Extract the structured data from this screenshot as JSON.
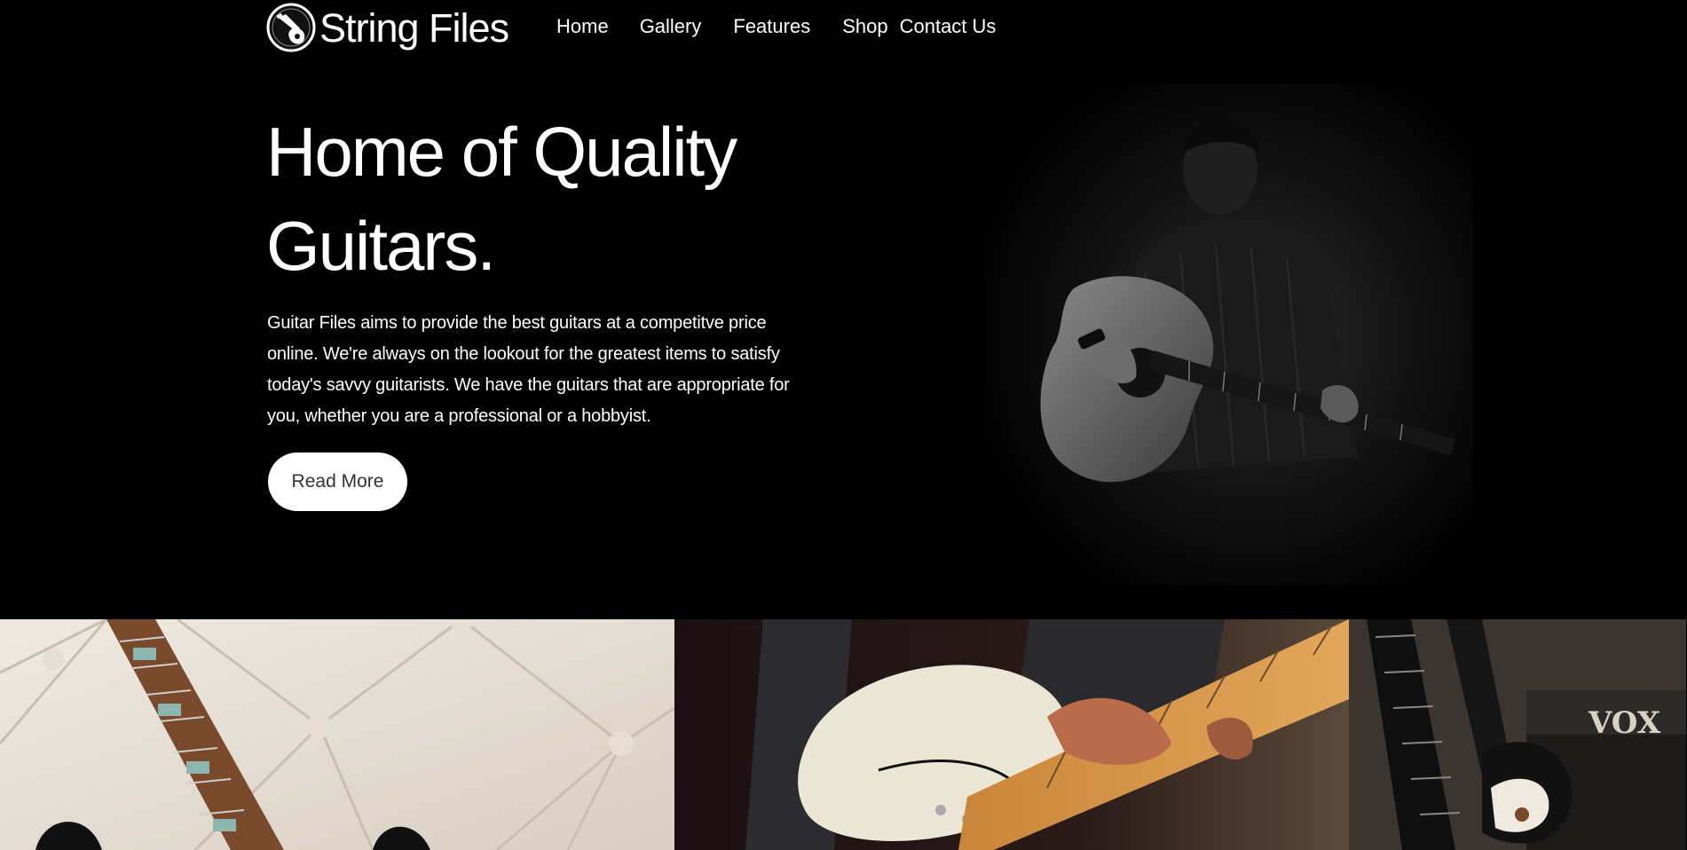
{
  "brand": {
    "name": "String Files",
    "logo_icon": "guitar-logo-icon"
  },
  "nav": {
    "items": [
      {
        "label": "Home"
      },
      {
        "label": "Gallery"
      },
      {
        "label": "Features"
      },
      {
        "label": "Shop"
      },
      {
        "label": "Contact Us"
      }
    ]
  },
  "hero": {
    "title": "Home of Quality Guitars.",
    "description": "Guitar Files aims to provide the best guitars at a competitve price online. We're always on the lookout for the greatest items to satisfy today's savvy guitarists. We have the guitars that are appropriate for you, whether you are a professional or a hobbyist.",
    "button_label": "Read More",
    "image": "man-playing-acoustic-guitar-photo"
  },
  "gallery": {
    "images": [
      {
        "image": "guitar-on-white-tufted-leather-photo"
      },
      {
        "image": "person-playing-white-electric-guitar-photo"
      },
      {
        "image": "electric-guitars-and-amplifier-photo",
        "amp_brand": "VOX"
      }
    ]
  },
  "colors": {
    "background": "#000000",
    "text": "#ffffff",
    "button_background": "#ffffff",
    "button_text": "#333333"
  }
}
